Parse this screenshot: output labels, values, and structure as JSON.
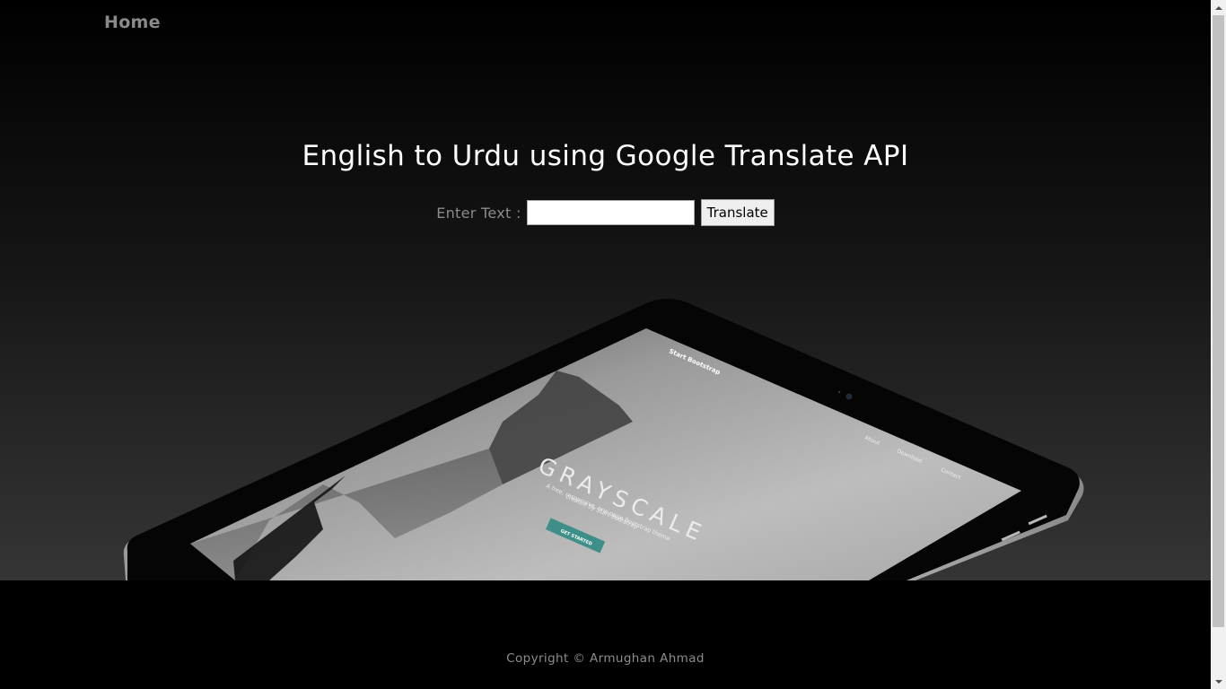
{
  "nav": {
    "home_label": "Home"
  },
  "main": {
    "title": "English to Urdu using Google Translate API",
    "input_label": "Enter Text :",
    "input_value": "",
    "translate_label": "Translate"
  },
  "tablet_screen": {
    "brand": "Start Bootstrap",
    "nav_items": [
      "About",
      "Download",
      "Contact"
    ],
    "heading": "GRAYSCALE",
    "subtitle_line1": "A free, responsive, one page Bootstrap theme",
    "subtitle_line2": "created by Start Bootstrap",
    "cta": "GET STARTED"
  },
  "footer": {
    "copyright": "Copyright © Armughan Ahmad"
  },
  "colors": {
    "nav_text": "#8a8a8a",
    "title_text": "#ffffff",
    "cta_accent": "#3e8f8a",
    "footer_bg": "#000000"
  }
}
